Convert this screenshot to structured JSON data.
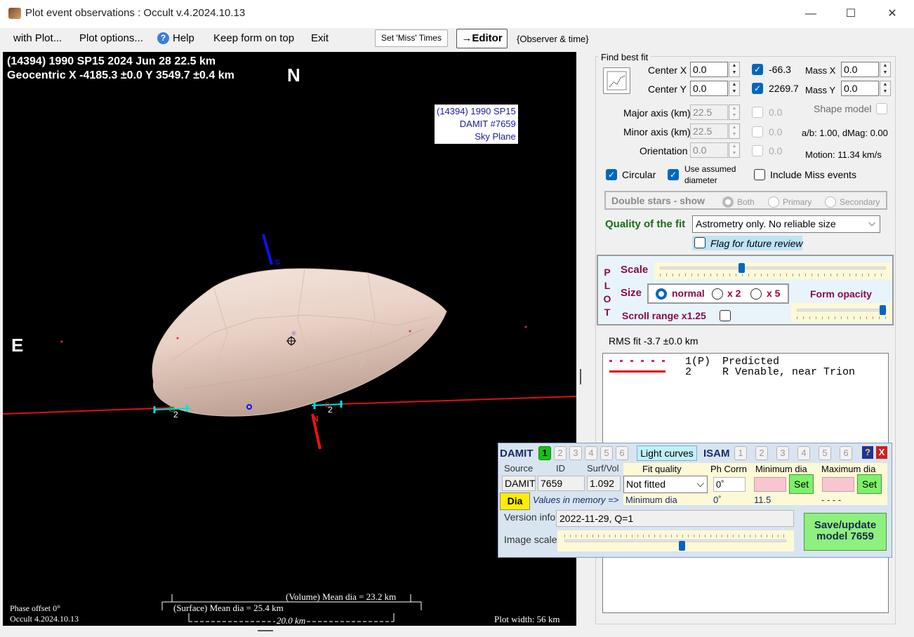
{
  "window": {
    "title": "Plot event observations : Occult v.4.2024.10.13",
    "minimize": "—",
    "maximize": "☐",
    "close": "✕"
  },
  "menu": {
    "with_plot": "with Plot...",
    "plot_options": "Plot options...",
    "help": "Help",
    "keep_on_top": "Keep form on top",
    "exit": "Exit",
    "set_miss_times": "Set 'Miss' Times",
    "editor": "→Editor",
    "observer_time": "{Observer & time}"
  },
  "plot": {
    "header_line1": "(14394) 1990 SP15  2024 Jun 28   22.5 km",
    "header_line2": "Geocentric X -4185.3 ±0.0 Y 3549.7 ±0.4 km",
    "north": "N",
    "east": "E",
    "legend_line1": "(14394) 1990 SP15",
    "legend_line2": "DAMIT #7659",
    "legend_line3": "Sky Plane",
    "pole_s": "S",
    "pole_n": "N",
    "chord_label_left": "2",
    "chord_label_right": "2",
    "volume_dia": "(Volume) Mean dia = 23.2 km",
    "surface_dia": "(Surface) Mean dia = 25.4 km",
    "scale_bar": "20.0 km",
    "phase_offset": "Phase offset 0°",
    "version": "Occult 4.2024.10.13",
    "plot_width": "Plot width: 56 km"
  },
  "fit": {
    "group_title": "Find best fit",
    "center_x_label": "Center X",
    "center_x": "0.0",
    "center_y_label": "Center Y",
    "center_y": "0.0",
    "cx_check_value": "-66.3",
    "cy_check_value": "2269.7",
    "mass_x_label": "Mass X",
    "mass_x": "0.0",
    "mass_y_label": "Mass Y",
    "mass_y": "0.0",
    "major_label": "Major axis (km)",
    "major": "22.5",
    "major_check": "0.0",
    "minor_label": "Minor axis (km)",
    "minor": "22.5",
    "minor_check": "0.0",
    "orient_label": "Orientation",
    "orient": "0.0",
    "orient_check": "0.0",
    "shape_model": "Shape model",
    "ab_dmag": "a/b: 1.00, dMag: 0.00",
    "motion": "Motion: 11.34 km/s",
    "circular": "Circular",
    "use_assumed": "Use assumed diameter",
    "include_miss": "Include Miss events",
    "double_stars": "Double stars - show",
    "both": "Both",
    "primary": "Primary",
    "secondary": "Secondary",
    "quality_label": "Quality of the fit",
    "quality_value": "Astrometry only. No reliable size",
    "flag_review": "Flag for future review"
  },
  "plot_panel": {
    "letters": [
      "P",
      "L",
      "O",
      "T"
    ],
    "scale": "Scale",
    "scale_level": 0.36,
    "size": "Size",
    "normal": "normal",
    "x2": "x 2",
    "x5": "x 5",
    "form_opacity": "Form opacity",
    "opacity_level": 0.95,
    "scroll_range": "Scroll range x1.25"
  },
  "rms": "RMS fit -3.7 ±0.0 km",
  "observers": [
    {
      "num": "1(P)",
      "name": "Predicted",
      "color": "#e0207a"
    },
    {
      "num": "2",
      "name": "R Venable, near Trion",
      "color": "#e00000"
    }
  ],
  "damit": {
    "title": "DAMIT",
    "tabs": [
      "1",
      "2",
      "3",
      "4",
      "5",
      "6"
    ],
    "light_curves": "Light curves",
    "isam": "ISAM",
    "isam_tabs": [
      "1",
      "2",
      "3",
      "4",
      "5",
      "6"
    ],
    "help": "?",
    "close": "X",
    "source_label": "Source",
    "id_label": "ID",
    "surfvol_label": "Surf/Vol",
    "source": "DAMIT",
    "id": "7659",
    "surfvol": "1.092",
    "fit_quality_label": "Fit quality",
    "fit_quality": "Not fitted",
    "ph_corrn_label": "Ph Corrn",
    "ph_corrn": "0˚",
    "min_dia_label": "Minimum dia",
    "max_dia_label": "Maximum dia",
    "set": "Set",
    "dia": "Dia",
    "values_memory": "Values in memory =>",
    "min_dia_mem_label": "Minimum dia",
    "ph_mem": "0˚",
    "min_mem": "11.5",
    "max_mem": "- - - -",
    "version_label": "Version info",
    "version": "2022-11-29, Q=1",
    "image_scale": "Image scale",
    "image_scale_level": 0.53,
    "save_update": "Save/update model 7659"
  }
}
